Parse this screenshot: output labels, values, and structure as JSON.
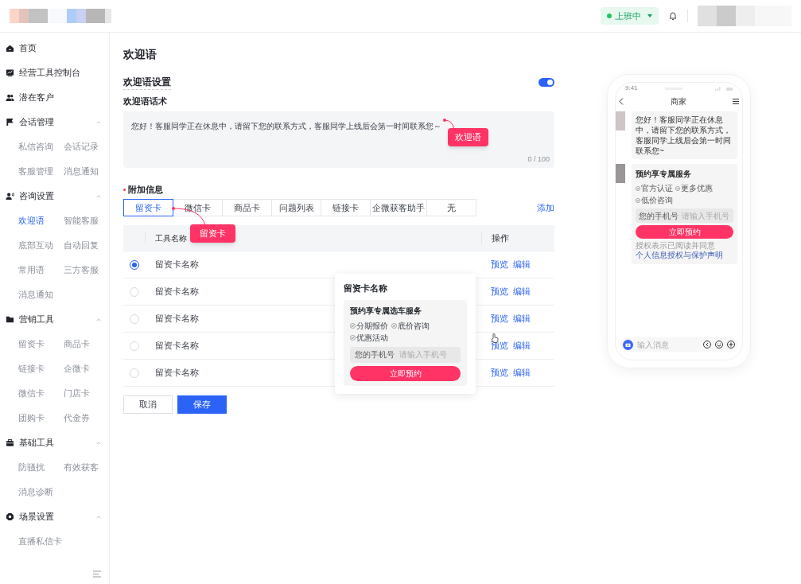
{
  "header": {
    "status": {
      "label": "上班中",
      "color": "#22c55e"
    }
  },
  "sidebar": {
    "groups": [
      {
        "label": "首页"
      },
      {
        "label": "经营工具控制台"
      },
      {
        "label": "潜在客户"
      },
      {
        "label": "会话管理",
        "expanded": true,
        "children": [
          {
            "label": "私信咨询",
            "selected": false
          },
          {
            "label": "会话记录",
            "selected": false
          },
          {
            "label": "客服管理",
            "selected": false
          },
          {
            "label": "消息通知",
            "selected": false
          }
        ]
      },
      {
        "label": "咨询设置",
        "expanded": true,
        "children": [
          {
            "label": "欢迎语",
            "selected": true
          },
          {
            "label": "智能客服",
            "selected": false
          },
          {
            "label": "底部互动",
            "selected": false
          },
          {
            "label": "自动回复",
            "selected": false
          },
          {
            "label": "常用语",
            "selected": false
          },
          {
            "label": "三方客服",
            "selected": false
          },
          {
            "label": "消息通知",
            "selected": false
          }
        ]
      },
      {
        "label": "营销工具",
        "expanded": true,
        "children": [
          {
            "label": "留资卡",
            "selected": false
          },
          {
            "label": "商品卡",
            "selected": false
          },
          {
            "label": "链接卡",
            "selected": false
          },
          {
            "label": "企微卡",
            "selected": false
          },
          {
            "label": "微信卡",
            "selected": false
          },
          {
            "label": "门店卡",
            "selected": false
          },
          {
            "label": "团购卡",
            "selected": false
          },
          {
            "label": "代金券",
            "selected": false
          }
        ]
      },
      {
        "label": "基础工具",
        "expanded": true,
        "children": [
          {
            "label": "防骚扰",
            "selected": false
          },
          {
            "label": "有效获客",
            "selected": false
          },
          {
            "label": "消息诊断",
            "selected": false
          }
        ]
      },
      {
        "label": "场景设置",
        "expanded": true,
        "children": [
          {
            "label": "直播私信卡",
            "selected": false
          }
        ]
      }
    ]
  },
  "page": {
    "title": "欢迎语",
    "section": {
      "title": "欢迎语设置",
      "toggle": {
        "on": true
      }
    },
    "message_field": {
      "label": "欢迎语话术",
      "value": "您好！客服同学正在休息中，请留下您的联系方式，客服同学上线后会第一时间联系您～",
      "counter": "0 / 100",
      "callout": "欢迎语"
    },
    "extra": {
      "label": "附加信息",
      "required": true,
      "add_link": "添加",
      "callout": "留资卡",
      "tabs": [
        {
          "label": "留资卡",
          "selected": true
        },
        {
          "label": "微信卡",
          "selected": false
        },
        {
          "label": "商品卡",
          "selected": false
        },
        {
          "label": "问题列表",
          "selected": false
        },
        {
          "label": "链接卡",
          "selected": false
        },
        {
          "label": "企微获客助手",
          "selected": false
        },
        {
          "label": "无",
          "selected": false
        }
      ]
    },
    "table": {
      "columns": [
        "工具名称",
        "操作"
      ],
      "rows": [
        {
          "name": "留资卡名称",
          "selected": true,
          "actions": [
            "预览",
            "编辑"
          ]
        },
        {
          "name": "留资卡名称",
          "selected": false,
          "actions": [
            "预览",
            "编辑"
          ]
        },
        {
          "name": "留资卡名称",
          "selected": false,
          "actions": [
            "预览",
            "编辑"
          ]
        },
        {
          "name": "留资卡名称",
          "selected": false,
          "actions": [
            "预览",
            "编辑"
          ]
        },
        {
          "name": "留资卡名称",
          "selected": false,
          "actions": [
            "预览",
            "编辑"
          ]
        }
      ]
    },
    "popover": {
      "title": "留资卡名称",
      "card_title": "预约享专属选车服务",
      "checks": [
        "分期报价",
        "底价咨询",
        "优惠活动"
      ],
      "phone_label": "您的手机号",
      "phone_placeholder": "请输入手机号",
      "button": "立即预约"
    },
    "buttons": [
      "取消",
      "保存"
    ]
  },
  "preview": {
    "time": "9:41",
    "title": "商家",
    "message": "您好！客服同学正在休息中，请留下您的联系方式，客服同学上线后会第一时间联系您~",
    "card_title": "预约享专属服务",
    "checks": [
      "官方认证",
      "更多优惠",
      "低价咨询"
    ],
    "phone_label": "您的手机号",
    "phone_placeholder": "请输入手机号",
    "button": "立即预约",
    "consent": "授权表示已阅读并同意",
    "consent_link": "个人信息授权与保护声明",
    "input_placeholder": "输入消息"
  }
}
